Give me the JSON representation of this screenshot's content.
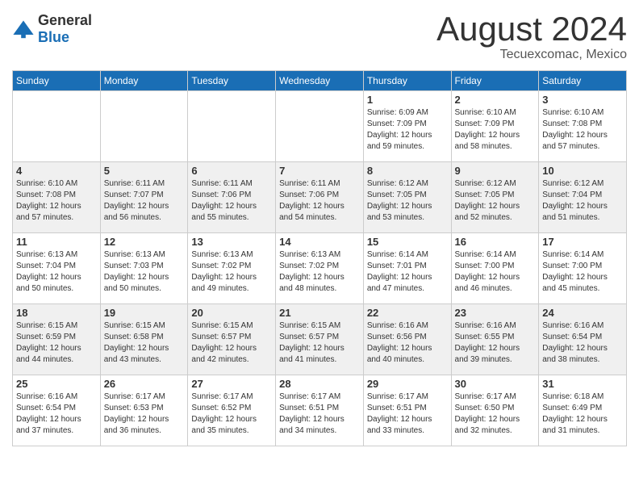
{
  "header": {
    "logo": {
      "general": "General",
      "blue": "Blue"
    },
    "title": "August 2024",
    "location": "Tecuexcomac, Mexico"
  },
  "weekdays": [
    "Sunday",
    "Monday",
    "Tuesday",
    "Wednesday",
    "Thursday",
    "Friday",
    "Saturday"
  ],
  "weeks": [
    [
      {
        "day": "",
        "sunrise": "",
        "sunset": "",
        "daylight": ""
      },
      {
        "day": "",
        "sunrise": "",
        "sunset": "",
        "daylight": ""
      },
      {
        "day": "",
        "sunrise": "",
        "sunset": "",
        "daylight": ""
      },
      {
        "day": "",
        "sunrise": "",
        "sunset": "",
        "daylight": ""
      },
      {
        "day": "1",
        "sunrise": "Sunrise: 6:09 AM",
        "sunset": "Sunset: 7:09 PM",
        "daylight": "Daylight: 12 hours and 59 minutes."
      },
      {
        "day": "2",
        "sunrise": "Sunrise: 6:10 AM",
        "sunset": "Sunset: 7:09 PM",
        "daylight": "Daylight: 12 hours and 58 minutes."
      },
      {
        "day": "3",
        "sunrise": "Sunrise: 6:10 AM",
        "sunset": "Sunset: 7:08 PM",
        "daylight": "Daylight: 12 hours and 57 minutes."
      }
    ],
    [
      {
        "day": "4",
        "sunrise": "Sunrise: 6:10 AM",
        "sunset": "Sunset: 7:08 PM",
        "daylight": "Daylight: 12 hours and 57 minutes."
      },
      {
        "day": "5",
        "sunrise": "Sunrise: 6:11 AM",
        "sunset": "Sunset: 7:07 PM",
        "daylight": "Daylight: 12 hours and 56 minutes."
      },
      {
        "day": "6",
        "sunrise": "Sunrise: 6:11 AM",
        "sunset": "Sunset: 7:06 PM",
        "daylight": "Daylight: 12 hours and 55 minutes."
      },
      {
        "day": "7",
        "sunrise": "Sunrise: 6:11 AM",
        "sunset": "Sunset: 7:06 PM",
        "daylight": "Daylight: 12 hours and 54 minutes."
      },
      {
        "day": "8",
        "sunrise": "Sunrise: 6:12 AM",
        "sunset": "Sunset: 7:05 PM",
        "daylight": "Daylight: 12 hours and 53 minutes."
      },
      {
        "day": "9",
        "sunrise": "Sunrise: 6:12 AM",
        "sunset": "Sunset: 7:05 PM",
        "daylight": "Daylight: 12 hours and 52 minutes."
      },
      {
        "day": "10",
        "sunrise": "Sunrise: 6:12 AM",
        "sunset": "Sunset: 7:04 PM",
        "daylight": "Daylight: 12 hours and 51 minutes."
      }
    ],
    [
      {
        "day": "11",
        "sunrise": "Sunrise: 6:13 AM",
        "sunset": "Sunset: 7:04 PM",
        "daylight": "Daylight: 12 hours and 50 minutes."
      },
      {
        "day": "12",
        "sunrise": "Sunrise: 6:13 AM",
        "sunset": "Sunset: 7:03 PM",
        "daylight": "Daylight: 12 hours and 50 minutes."
      },
      {
        "day": "13",
        "sunrise": "Sunrise: 6:13 AM",
        "sunset": "Sunset: 7:02 PM",
        "daylight": "Daylight: 12 hours and 49 minutes."
      },
      {
        "day": "14",
        "sunrise": "Sunrise: 6:13 AM",
        "sunset": "Sunset: 7:02 PM",
        "daylight": "Daylight: 12 hours and 48 minutes."
      },
      {
        "day": "15",
        "sunrise": "Sunrise: 6:14 AM",
        "sunset": "Sunset: 7:01 PM",
        "daylight": "Daylight: 12 hours and 47 minutes."
      },
      {
        "day": "16",
        "sunrise": "Sunrise: 6:14 AM",
        "sunset": "Sunset: 7:00 PM",
        "daylight": "Daylight: 12 hours and 46 minutes."
      },
      {
        "day": "17",
        "sunrise": "Sunrise: 6:14 AM",
        "sunset": "Sunset: 7:00 PM",
        "daylight": "Daylight: 12 hours and 45 minutes."
      }
    ],
    [
      {
        "day": "18",
        "sunrise": "Sunrise: 6:15 AM",
        "sunset": "Sunset: 6:59 PM",
        "daylight": "Daylight: 12 hours and 44 minutes."
      },
      {
        "day": "19",
        "sunrise": "Sunrise: 6:15 AM",
        "sunset": "Sunset: 6:58 PM",
        "daylight": "Daylight: 12 hours and 43 minutes."
      },
      {
        "day": "20",
        "sunrise": "Sunrise: 6:15 AM",
        "sunset": "Sunset: 6:57 PM",
        "daylight": "Daylight: 12 hours and 42 minutes."
      },
      {
        "day": "21",
        "sunrise": "Sunrise: 6:15 AM",
        "sunset": "Sunset: 6:57 PM",
        "daylight": "Daylight: 12 hours and 41 minutes."
      },
      {
        "day": "22",
        "sunrise": "Sunrise: 6:16 AM",
        "sunset": "Sunset: 6:56 PM",
        "daylight": "Daylight: 12 hours and 40 minutes."
      },
      {
        "day": "23",
        "sunrise": "Sunrise: 6:16 AM",
        "sunset": "Sunset: 6:55 PM",
        "daylight": "Daylight: 12 hours and 39 minutes."
      },
      {
        "day": "24",
        "sunrise": "Sunrise: 6:16 AM",
        "sunset": "Sunset: 6:54 PM",
        "daylight": "Daylight: 12 hours and 38 minutes."
      }
    ],
    [
      {
        "day": "25",
        "sunrise": "Sunrise: 6:16 AM",
        "sunset": "Sunset: 6:54 PM",
        "daylight": "Daylight: 12 hours and 37 minutes."
      },
      {
        "day": "26",
        "sunrise": "Sunrise: 6:17 AM",
        "sunset": "Sunset: 6:53 PM",
        "daylight": "Daylight: 12 hours and 36 minutes."
      },
      {
        "day": "27",
        "sunrise": "Sunrise: 6:17 AM",
        "sunset": "Sunset: 6:52 PM",
        "daylight": "Daylight: 12 hours and 35 minutes."
      },
      {
        "day": "28",
        "sunrise": "Sunrise: 6:17 AM",
        "sunset": "Sunset: 6:51 PM",
        "daylight": "Daylight: 12 hours and 34 minutes."
      },
      {
        "day": "29",
        "sunrise": "Sunrise: 6:17 AM",
        "sunset": "Sunset: 6:51 PM",
        "daylight": "Daylight: 12 hours and 33 minutes."
      },
      {
        "day": "30",
        "sunrise": "Sunrise: 6:17 AM",
        "sunset": "Sunset: 6:50 PM",
        "daylight": "Daylight: 12 hours and 32 minutes."
      },
      {
        "day": "31",
        "sunrise": "Sunrise: 6:18 AM",
        "sunset": "Sunset: 6:49 PM",
        "daylight": "Daylight: 12 hours and 31 minutes."
      }
    ]
  ]
}
